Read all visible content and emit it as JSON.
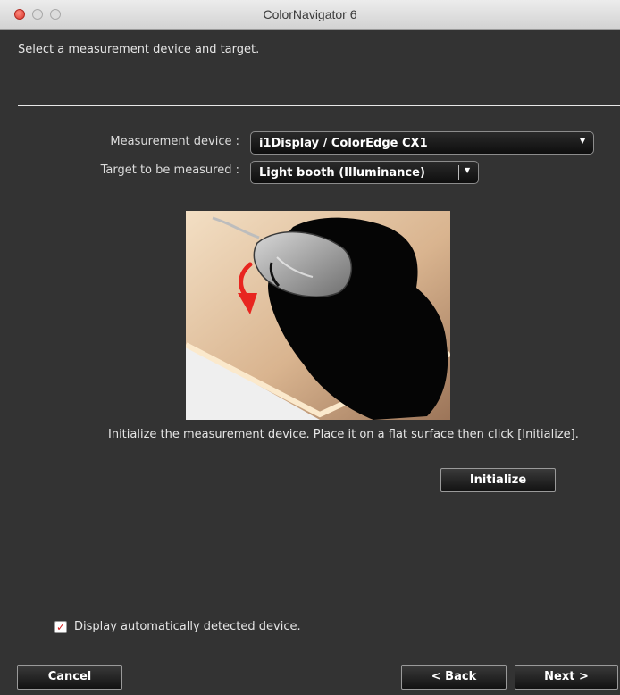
{
  "window": {
    "title": "ColorNavigator 6"
  },
  "header": {
    "instruction": "Select a measurement device and target."
  },
  "form": {
    "device_label": "Measurement device :",
    "device_value": "i1Display / ColorEdge CX1",
    "target_label": "Target to be measured :",
    "target_value": "Light booth (Illuminance)"
  },
  "illustration": {
    "arrow_color": "#e8251f"
  },
  "instructions": {
    "text": "Initialize the measurement device. Place it on a flat surface then click [Initialize].",
    "initialize_label": "Initialize"
  },
  "options": {
    "auto_detect_label": "Display automatically detected device.",
    "auto_detect_checked": true
  },
  "footer": {
    "cancel_label": "Cancel",
    "back_label": "< Back",
    "next_label": "Next >"
  },
  "colors": {
    "background": "#333333",
    "close_button": "#d8362b",
    "checkmark": "#d42020"
  },
  "icons": [
    "close-window-icon",
    "minimize-window-icon",
    "zoom-window-icon",
    "dropdown-arrow-icon",
    "checkmark-icon"
  ]
}
